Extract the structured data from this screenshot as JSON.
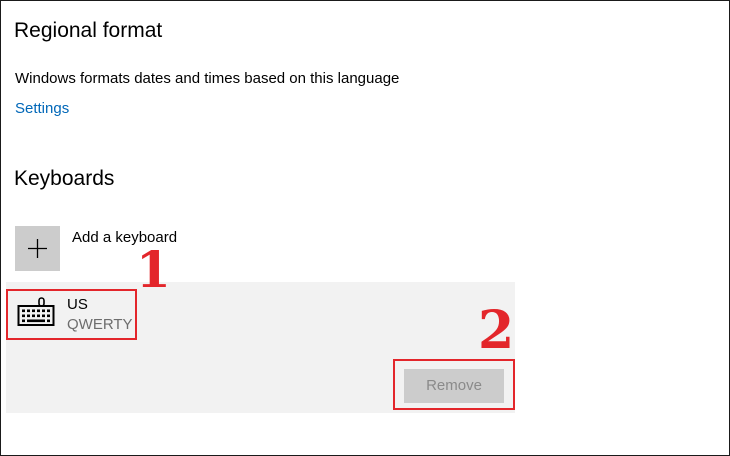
{
  "regional": {
    "title": "Regional format",
    "description": "Windows formats dates and times based on this language",
    "settings_link": "Settings"
  },
  "keyboards": {
    "title": "Keyboards",
    "add_label": "Add a keyboard",
    "items": [
      {
        "name": "US",
        "layout": "QWERTY",
        "icon": "keyboard-icon"
      }
    ],
    "remove_label": "Remove"
  },
  "annotations": {
    "marker_1": "1",
    "marker_2": "2",
    "highlight_color": "#e3262b"
  },
  "colors": {
    "link": "#0067b8",
    "panel_bg": "#f2f2f2",
    "button_bg": "#cccccc",
    "button_text_disabled": "#8a8a8a"
  }
}
